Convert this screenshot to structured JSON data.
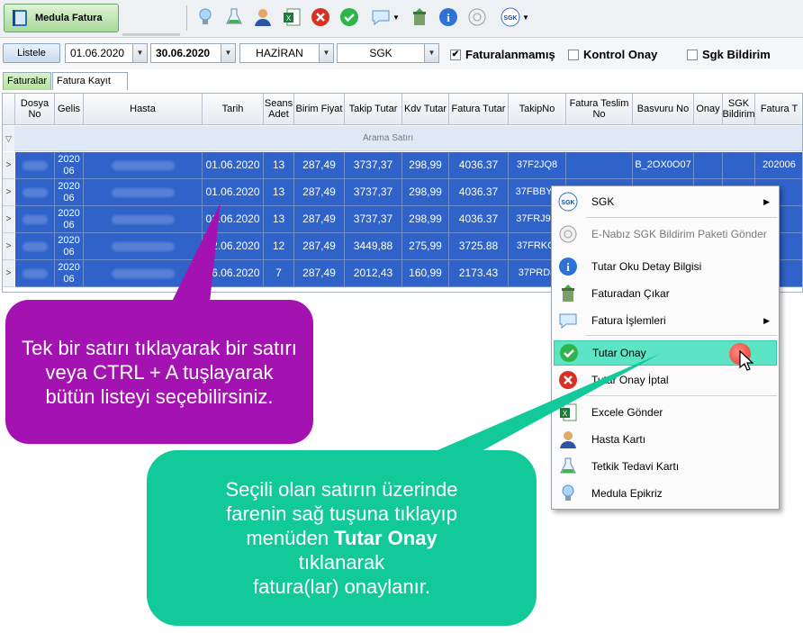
{
  "toolbar": {
    "app_tab_label": "Medula Fatura",
    "icons": [
      "lightbulb-icon",
      "flask-icon",
      "user-icon",
      "excel-icon",
      "close-circle-icon",
      "check-circle-icon",
      "speech-bubble-icon",
      "trash-icon",
      "info-icon",
      "enabiz-icon",
      "sgk-icon"
    ]
  },
  "filters": {
    "list_button": "Listele",
    "date_start": "01.06.2020",
    "date_end": "30.06.2020",
    "month": "HAZİRAN",
    "institution": "SGK",
    "chk_unbilled": "Faturalanmamış",
    "chk_control": "Kontrol Onay",
    "chk_sgk": "Sgk Bildirim"
  },
  "tabs": [
    "Faturalar",
    "Fatura Kayıt Log"
  ],
  "grid": {
    "columns": [
      "Dosya No",
      "Gelis",
      "Hasta",
      "Tarih",
      "Seans Adet",
      "Birim Fiyat",
      "Takip Tutar",
      "Kdv Tutar",
      "Fatura Tutar",
      "TakipNo",
      "Fatura Teslim No",
      "Basvuru No",
      "Onay",
      "SGK Bildirim",
      "Fatura T"
    ],
    "search_label": "Arama Satırı",
    "rows": [
      {
        "gelis": "2020 06",
        "tarih": "01.06.2020",
        "seans": "13",
        "birim": "287,49",
        "takip": "3737,37",
        "kdv": "298,99",
        "fatura": "4036.37",
        "takipno": "37F2JQ8",
        "basvuru": "B_2OX0O07",
        "faturat": "202006"
      },
      {
        "gelis": "2020 06",
        "tarih": "01.06.2020",
        "seans": "13",
        "birim": "287,49",
        "takip": "3737,37",
        "kdv": "298,99",
        "fatura": "4036.37",
        "takipno": "37FBBYF",
        "basvuru": "",
        "faturat": ""
      },
      {
        "gelis": "2020 06",
        "tarih": "01.06.2020",
        "seans": "13",
        "birim": "287,49",
        "takip": "3737,37",
        "kdv": "298,99",
        "fatura": "4036.37",
        "takipno": "37FRJ9C",
        "basvuru": "",
        "faturat": ""
      },
      {
        "gelis": "2020 06",
        "tarih": "02.06.2020",
        "seans": "12",
        "birim": "287,49",
        "takip": "3449,88",
        "kdv": "275,99",
        "fatura": "3725.88",
        "takipno": "37FRKCI",
        "basvuru": "",
        "faturat": ""
      },
      {
        "gelis": "2020 06",
        "tarih": "16.06.2020",
        "seans": "7",
        "birim": "287,49",
        "takip": "2012,43",
        "kdv": "160,99",
        "fatura": "2173.43",
        "takipno": "37PRD3",
        "basvuru": "",
        "faturat": ""
      }
    ]
  },
  "context_menu": {
    "items": [
      {
        "label": "SGK",
        "icon": "sgk-icon",
        "submenu": true
      },
      {
        "label": "E-Nabız SGK Bildirim Paketi Gönder",
        "icon": "enabiz-icon",
        "disabled": true
      },
      {
        "label": "Tutar Oku Detay Bilgisi",
        "icon": "info-icon"
      },
      {
        "label": "Faturadan Çıkar",
        "icon": "trash-icon"
      },
      {
        "label": "Fatura İşlemleri",
        "icon": "speech-bubble-icon",
        "submenu": true
      },
      {
        "label": "Tutar Onay",
        "icon": "check-circle-icon",
        "highlighted": true
      },
      {
        "label": "Tutar Onay İptal",
        "icon": "close-circle-icon"
      },
      {
        "label": "Excele Gönder",
        "icon": "excel-icon"
      },
      {
        "label": "Hasta Kartı",
        "icon": "user-icon"
      },
      {
        "label": "Tetkik Tedavi Kartı",
        "icon": "flask-icon"
      },
      {
        "label": "Medula Epikriz",
        "icon": "lightbulb-icon"
      }
    ]
  },
  "callouts": {
    "purple": "Tek bir satırı tıklayarak bir satırı veya CTRL + A tuşlayarak bütün listeyi seçebilirsiniz.",
    "teal_line1": "Seçili olan satırın üzerinde",
    "teal_line2": "farenin sağ tuşuna tıklayıp",
    "teal_line3a": "menüden ",
    "teal_bold": "Tutar Onay",
    "teal_line4": "tıklanarak",
    "teal_line5": "fatura(lar) onaylanır."
  },
  "colors": {
    "selection": "#2f63c9",
    "purple": "#a413b2",
    "teal": "#12c99a",
    "highlight": "#5ce4c4"
  }
}
